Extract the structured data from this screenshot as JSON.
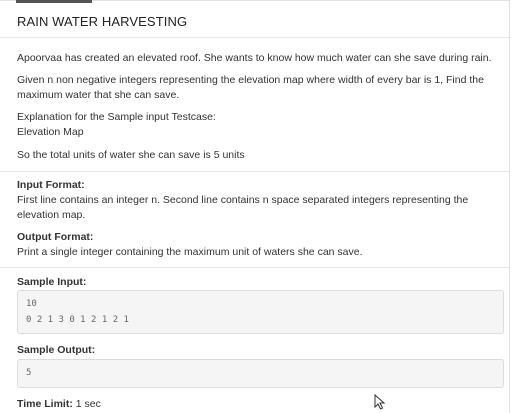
{
  "problem": {
    "title": "RAIN WATER HARVESTING",
    "intro": "Apoorvaa has created an elevated roof. She wants to know how much water can she save during rain.",
    "statement": "Given n non negative integers representing the elevation map where width of every bar is 1, Find the maximum water that she can save.",
    "explanation_heading": "Explanation for the Sample input Testcase:",
    "explanation_map": "Elevation Map",
    "explanation_result": "So the total units of water she can save is 5 units"
  },
  "input_format": {
    "label": "Input Format:",
    "text": "First line contains an integer n. Second line contains n space separated integers representing the elevation map."
  },
  "output_format": {
    "label": "Output Format:",
    "text": "Print a single integer containing the maximum unit of waters she can save."
  },
  "sample_input": {
    "label": "Sample Input:",
    "line1": "10",
    "line2": "0 2 1 3 0 1 2 1 2 1"
  },
  "sample_output": {
    "label": "Sample Output:",
    "line1": "5"
  },
  "time_limit": {
    "label": "Time Limit:",
    "value": "1 sec"
  }
}
